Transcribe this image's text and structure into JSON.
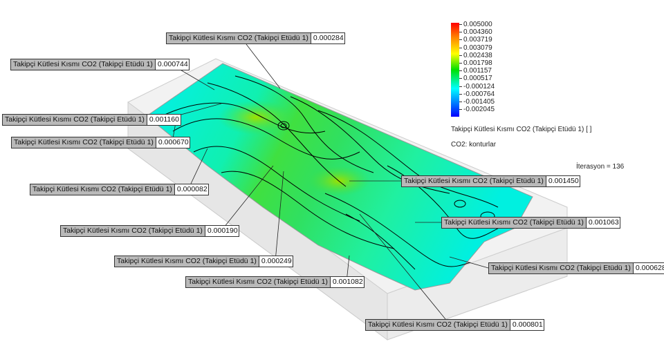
{
  "legend": {
    "ticks": [
      "0.005000",
      "0.004360",
      "0.003719",
      "0.003079",
      "0.002438",
      "0.001798",
      "0.001157",
      "0.000517",
      "-0.000124",
      "-0.000764",
      "-0.001405",
      "-0.002045"
    ],
    "title": "Takipçi Kütlesi Kısmı CO2 (Takipçi Etüdü 1) [ ]",
    "subtitle": "CO2: konturlar",
    "colors": [
      "#ff0000",
      "#ffff00",
      "#00e000",
      "#00ffff",
      "#0000ff"
    ]
  },
  "iteration": "İterasyon = 136",
  "probes": [
    {
      "label": "Takipçi Kütlesi Kısmı CO2 (Takipçi Etüdü 1)",
      "value": "0.000284"
    },
    {
      "label": "Takipçi Kütlesi Kısmı CO2 (Takipçi Etüdü 1)",
      "value": "0.000744"
    },
    {
      "label": "Takipçi Kütlesi Kısmı CO2 (Takipçi Etüdü 1)",
      "value": "0.001160"
    },
    {
      "label": "Takipçi Kütlesi Kısmı CO2 (Takipçi Etüdü 1)",
      "value": "0.000670"
    },
    {
      "label": "Takipçi Kütlesi Kısmı CO2 (Takipçi Etüdü 1)",
      "value": "0.000082"
    },
    {
      "label": "Takipçi Kütlesi Kısmı CO2 (Takipçi Etüdü 1)",
      "value": "0.000190"
    },
    {
      "label": "Takipçi Kütlesi Kısmı CO2 (Takipçi Etüdü 1)",
      "value": "0.000249"
    },
    {
      "label": "Takipçi Kütlesi Kısmı CO2 (Takipçi Etüdü 1)",
      "value": "0.001082"
    },
    {
      "label": "Takipçi Kütlesi Kısmı CO2 (Takipçi Etüdü 1)",
      "value": "0.001450"
    },
    {
      "label": "Takipçi Kütlesi Kısmı CO2 (Takipçi Etüdü 1)",
      "value": "0.001063"
    },
    {
      "label": "Takipçi Kütlesi Kısmı CO2 (Takipçi Etüdü 1)",
      "value": "0.000628"
    },
    {
      "label": "Takipçi Kütlesi Kısmı CO2 (Takipçi Etüdü 1)",
      "value": "0.000801"
    }
  ]
}
